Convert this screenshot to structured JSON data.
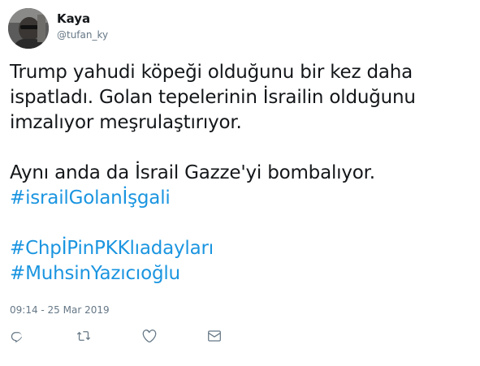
{
  "author": {
    "name": "Kaya",
    "handle": "@tufan_ky"
  },
  "tweet": {
    "line1": "Trump yahudi köpeği olduğunu bir kez daha",
    "line2": "ispatladı. Golan tepelerinin İsrailin olduğunu",
    "line3": "imzalıyor meşrulaştırıyor.",
    "line4": "Aynı anda da İsrail Gazze'yi bombalıyor.",
    "hashtags": [
      "#israilGolanİşgali",
      "#ChpİPinPKKlıadayları",
      "#MuhsinYazıcıoğlu"
    ]
  },
  "timestamp": "09:14 - 25 Mar 2019",
  "actions": {
    "reply_icon": "reply-icon",
    "retweet_icon": "retweet-icon",
    "like_icon": "heart-icon",
    "dm_icon": "envelope-icon"
  },
  "colors": {
    "hashtag": "#1b95e0",
    "secondary_text": "#657786",
    "primary_text": "#14171a"
  }
}
